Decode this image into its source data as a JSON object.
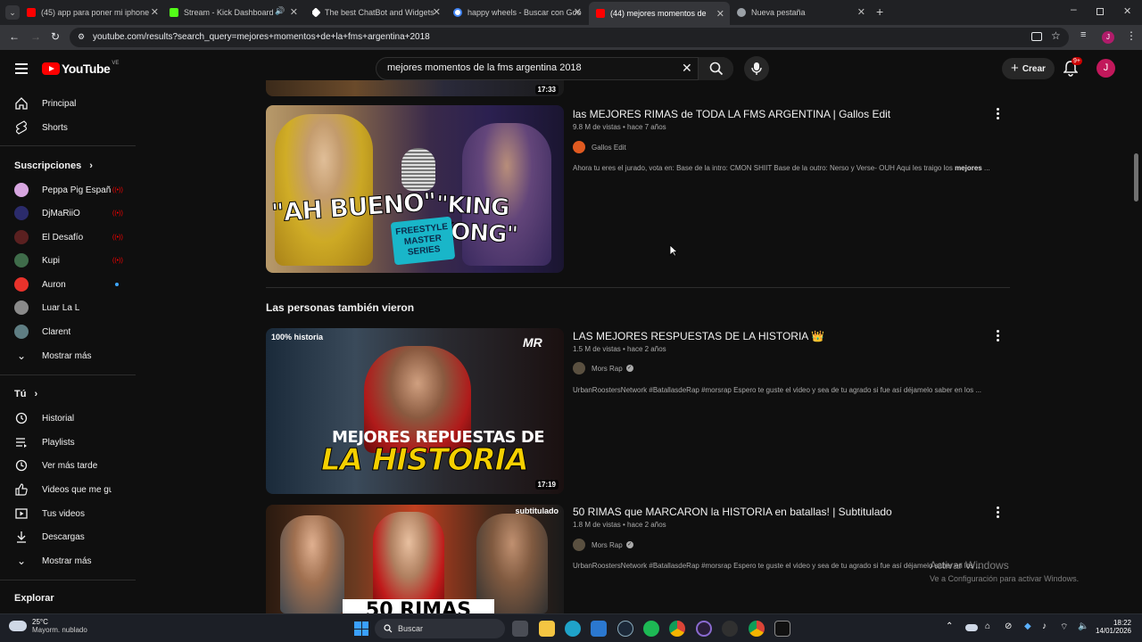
{
  "browser": {
    "tabs": [
      {
        "label": "(45) app para poner mi iphone",
        "favicon_color": "#ff0000"
      },
      {
        "label": "Stream - Kick Dashboard",
        "favicon_color": "#53fc18"
      },
      {
        "label": "The best ChatBot and Widgets",
        "favicon_color": "#ffffff"
      },
      {
        "label": "happy wheels - Buscar con Goo",
        "favicon_color": "#4285f4"
      },
      {
        "label": "(44) mejores momentos de la fr",
        "favicon_color": "#ff0000"
      },
      {
        "label": "Nueva pestaña",
        "favicon_color": "#9aa0a6"
      }
    ],
    "url": "youtube.com/results?search_query=mejores+momentos+de+la+fms+argentina+2018",
    "profile_initial": "J"
  },
  "header": {
    "logo_text": "YouTube",
    "country": "VE",
    "search_value": "mejores momentos de la fms argentina 2018",
    "create_label": "Crear",
    "notif_count": "9+",
    "avatar_initial": "J"
  },
  "sidebar": {
    "main": [
      {
        "label": "Principal",
        "icon": "home-icon"
      },
      {
        "label": "Shorts",
        "icon": "shorts-icon"
      }
    ],
    "subs_title": "Suscripciones",
    "subs": [
      {
        "label": "Peppa Pig Españ...",
        "color": "#d7a6e0",
        "live": true
      },
      {
        "label": "DjMaRiiO",
        "color": "#2b2b6b",
        "live": true
      },
      {
        "label": "El Desafío",
        "color": "#5a2020",
        "live": true
      },
      {
        "label": "Kupi",
        "color": "#3f6c4a",
        "live": true
      },
      {
        "label": "Auron",
        "color": "#e8322b",
        "live": false
      },
      {
        "label": "Luar La L",
        "color": "#8a8a8a",
        "live": false
      },
      {
        "label": "Clarent",
        "color": "#5f7e83",
        "live": false
      }
    ],
    "show_more": "Mostrar más",
    "you_title": "Tú",
    "you_items": [
      {
        "label": "Historial",
        "icon": "history-icon"
      },
      {
        "label": "Playlists",
        "icon": "playlists-icon"
      },
      {
        "label": "Ver más tarde",
        "icon": "watch-later-icon"
      },
      {
        "label": "Videos que me gus...",
        "icon": "like-icon"
      },
      {
        "label": "Tus videos",
        "icon": "your-videos-icon"
      },
      {
        "label": "Descargas",
        "icon": "download-icon"
      }
    ],
    "show_more_2": "Mostrar más",
    "explore_title": "Explorar"
  },
  "results": {
    "top_partial_duration": "17:33",
    "video1": {
      "title": "las MEJORES RIMAS de TODA LA FMS ARGENTINA | Gallos Edit",
      "meta": "9.8 M de vistas • hace 7 años",
      "channel": "Gallos Edit",
      "desc_pre": "Ahora tu eres el jurado, vota en: Base de la intro: CMON SHIIT Base de la outro: Nerso y Verse- OUH Aqui les traigo los ",
      "desc_bold": "mejores",
      "desc_post": " ...",
      "thumb_text_left": "\"AH BUENO\"",
      "thumb_text_right": "\"KING KONG\"",
      "thumb_badge": "FREESTYLE MASTER SERIES"
    },
    "section_title": "Las personas también vieron",
    "video2": {
      "title": "LAS MEJORES RESPUESTAS DE LA HISTORIA 👑",
      "meta": "1.5 M de vistas • hace 2 años",
      "channel": "Mors Rap",
      "desc": "UrbanRoostersNetwork #BatallasdeRap #morsrap Espero te guste el video y sea de tu agrado si fue así déjamelo saber en los ...",
      "duration": "17:19",
      "thumb_corner": "100% historia",
      "thumb_line1": "MEJORES REPUESTAS DE",
      "thumb_line2": "LA HISTORIA",
      "thumb_logo": "MR"
    },
    "video3": {
      "title": "50 RIMAS que MARCARON la HISTORIA en batallas! | Subtitulado",
      "meta": "1.8 M de vistas • hace 2 años",
      "channel": "Mors Rap",
      "desc": "UrbanRoostersNetwork #BatallasdeRap #morsrap Espero te guste el video y sea de tu agrado si fue así déjamelo saber en los ...",
      "thumb_corner": "subtitulado",
      "thumb_bottom": "50 RIMAS"
    }
  },
  "watermark": {
    "line1": "Activar Windows",
    "line2": "Ve a Configuración para activar Windows."
  },
  "taskbar": {
    "weather_temp": "25°C",
    "weather_desc": "Mayorm. nublado",
    "search_label": "Buscar",
    "time": "18:22",
    "date": "14/01/2026"
  }
}
